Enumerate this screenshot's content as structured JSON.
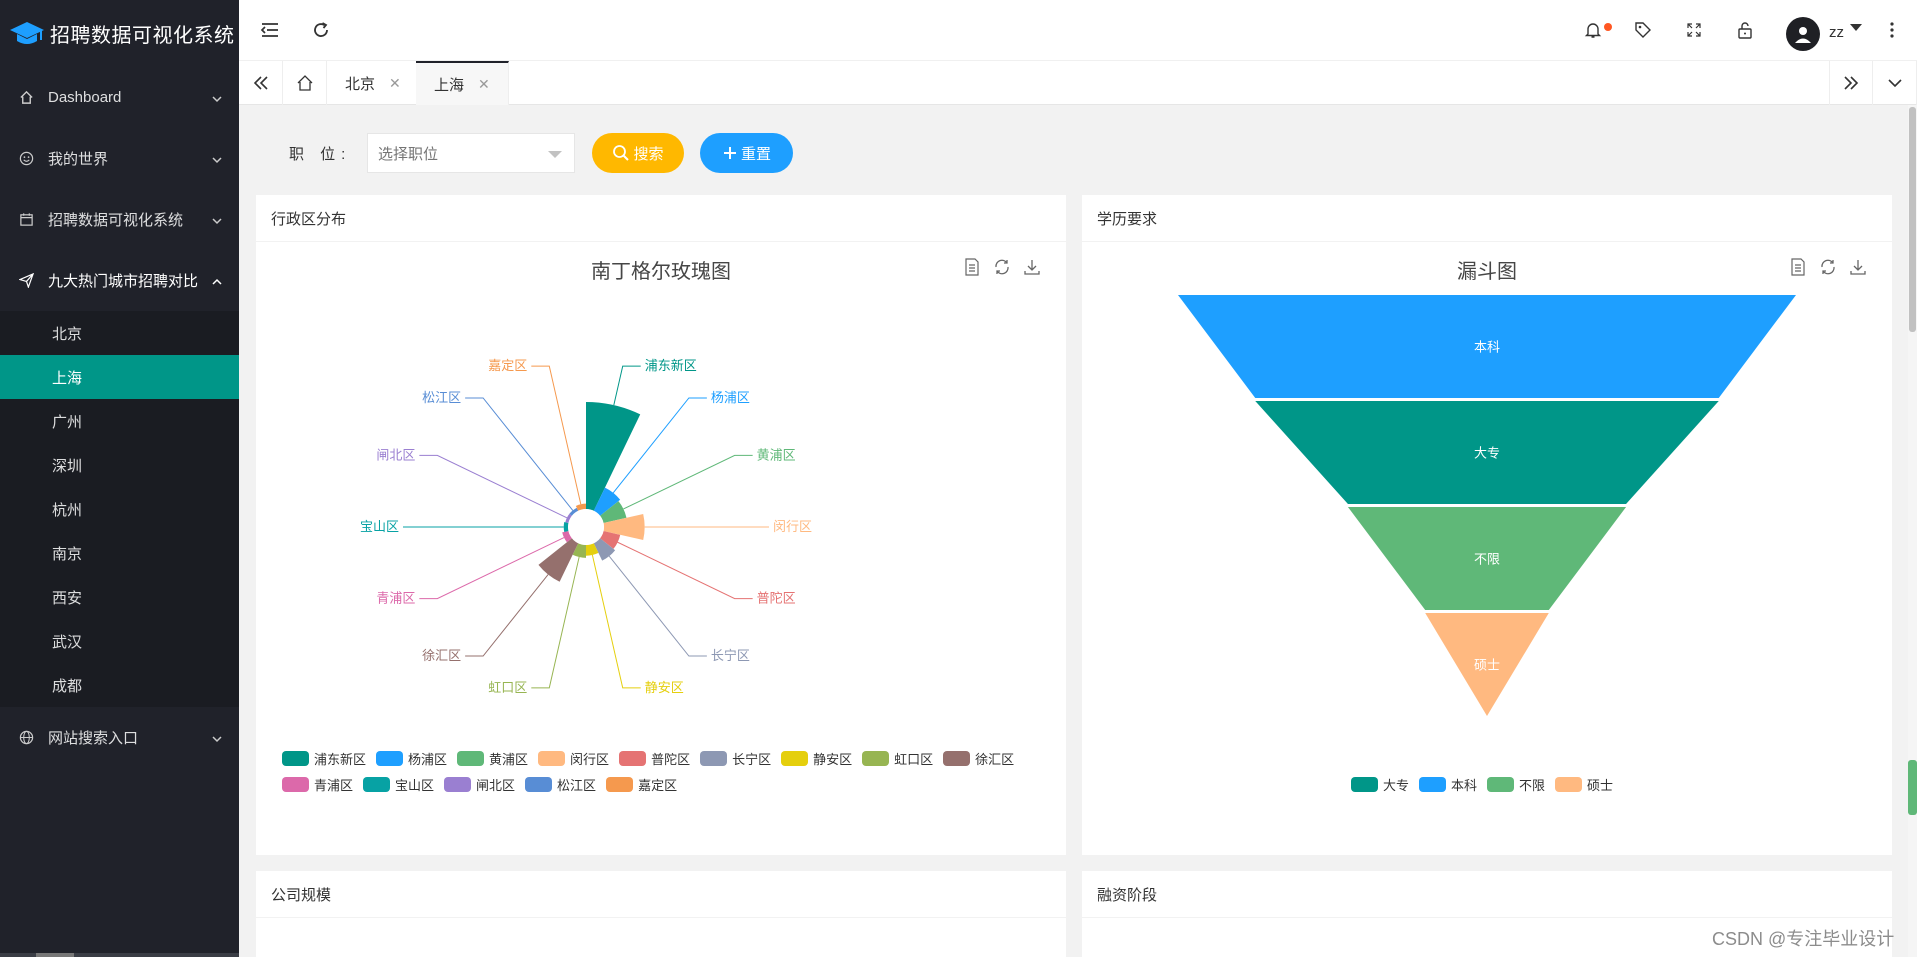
{
  "app": {
    "title": "招聘数据可视化系统"
  },
  "sidebar": {
    "items": [
      {
        "label": "Dashboard",
        "icon": "home-icon"
      },
      {
        "label": "我的世界",
        "icon": "smile-icon"
      },
      {
        "label": "招聘数据可视化系统",
        "icon": "calendar-icon"
      },
      {
        "label": "九大热门城市招聘对比",
        "icon": "paper-plane-icon",
        "open": true
      },
      {
        "label": "网站搜索入口",
        "icon": "globe-icon"
      }
    ],
    "submenu": [
      "北京",
      "上海",
      "广州",
      "深圳",
      "杭州",
      "南京",
      "西安",
      "武汉",
      "成都"
    ],
    "active_sub": "上海"
  },
  "header": {
    "username": "zz"
  },
  "tabs": [
    {
      "label": "北京",
      "active": false
    },
    {
      "label": "上海",
      "active": true
    }
  ],
  "filter": {
    "label": "职 位:",
    "placeholder": "选择职位",
    "search_label": "搜索",
    "reset_label": "重置"
  },
  "cards": {
    "district": "行政区分布",
    "education": "学历要求",
    "company_size": "公司规模",
    "funding": "融资阶段"
  },
  "colors": {
    "sidebar_bg": "#20222a",
    "active_green": "#009688",
    "search_btn": "#ffb800",
    "reset_btn": "#1e9fff"
  },
  "chart_data": [
    {
      "type": "rose",
      "title": "南丁格尔玫瑰图",
      "categories": [
        "浦东新区",
        "杨浦区",
        "黄浦区",
        "闵行区",
        "普陀区",
        "长宁区",
        "静安区",
        "虹口区",
        "徐汇区",
        "青浦区",
        "宝山区",
        "闸北区",
        "松江区",
        "嘉定区"
      ],
      "values": [
        100,
        24,
        22,
        38,
        16,
        18,
        10,
        12,
        40,
        6,
        4,
        3,
        3,
        5
      ],
      "colors": [
        "#009688",
        "#1e9fff",
        "#5fb878",
        "#ffb980",
        "#e57373",
        "#8d98b3",
        "#e5cf0d",
        "#97b552",
        "#95706d",
        "#dc69aa",
        "#07a2a4",
        "#9a7fd1",
        "#588dd5",
        "#f5994e"
      ],
      "legend_position": "bottom"
    },
    {
      "type": "funnel",
      "title": "漏斗图",
      "categories": [
        "本科",
        "大专",
        "不限",
        "硕士"
      ],
      "values": [
        100,
        75,
        45,
        20
      ],
      "colors": [
        "#1e9fff",
        "#009688",
        "#5fb878",
        "#ffb980"
      ],
      "legend": [
        "大专",
        "本科",
        "不限",
        "硕士"
      ],
      "legend_colors": [
        "#009688",
        "#1e9fff",
        "#5fb878",
        "#ffb980"
      ],
      "legend_position": "bottom"
    }
  ],
  "watermark": "CSDN @专注毕业设计"
}
